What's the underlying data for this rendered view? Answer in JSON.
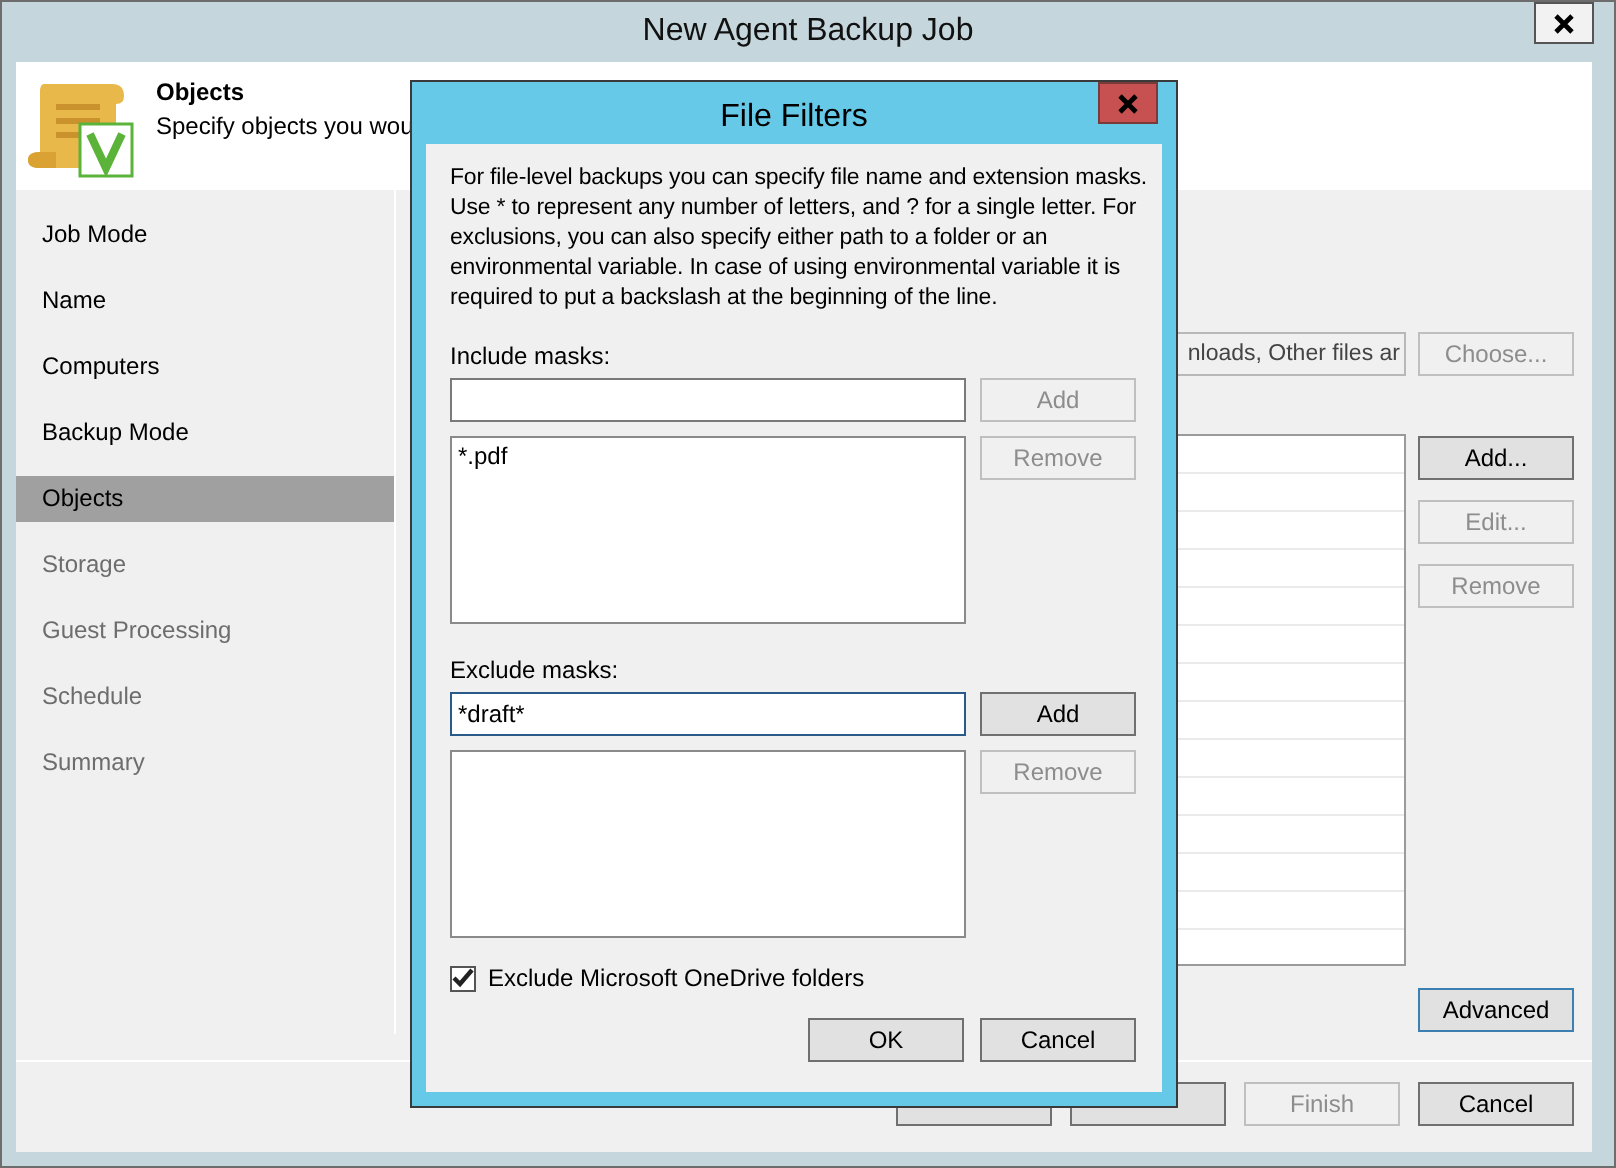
{
  "window": {
    "title": "New Agent Backup Job"
  },
  "header": {
    "title": "Objects",
    "subtitle": "Specify objects you wou"
  },
  "steps": [
    {
      "label": "Job Mode",
      "selected": false,
      "disabled": false
    },
    {
      "label": "Name",
      "selected": false,
      "disabled": false
    },
    {
      "label": "Computers",
      "selected": false,
      "disabled": false
    },
    {
      "label": "Backup Mode",
      "selected": false,
      "disabled": false
    },
    {
      "label": "Objects",
      "selected": true,
      "disabled": false
    },
    {
      "label": "Storage",
      "selected": false,
      "disabled": true
    },
    {
      "label": "Guest Processing",
      "selected": false,
      "disabled": true
    },
    {
      "label": "Schedule",
      "selected": false,
      "disabled": true
    },
    {
      "label": "Summary",
      "selected": false,
      "disabled": true
    }
  ],
  "objects": {
    "selection_field": "nloads, Other files ar",
    "choose_button": {
      "label": "Choose...",
      "disabled": true
    },
    "list_buttons": [
      {
        "label": "Add...",
        "disabled": false
      },
      {
        "label": "Edit...",
        "disabled": true
      },
      {
        "label": "Remove",
        "disabled": true
      }
    ],
    "advanced_button": {
      "label": "Advanced",
      "focused": true
    }
  },
  "footer_buttons": [
    {
      "disabled": false
    },
    {
      "disabled": false
    },
    {
      "label": "Finish",
      "disabled": true
    },
    {
      "label": "Cancel",
      "disabled": false
    }
  ],
  "dialog": {
    "title": "File Filters",
    "description": "For file-level backups you can specify file name and extension masks. Use * to represent any number of letters, and ? for a single letter. For exclusions, you can also specify either path to a folder or an environmental variable. In case of using environmental variable it is required to put a backslash at the beginning of the line.",
    "sections": [
      {
        "label": "Include masks:",
        "focused": false,
        "add_button": {
          "label": "Add",
          "disabled": true
        },
        "items": [
          "*.pdf"
        ],
        "remove_button": {
          "label": "Remove",
          "disabled": true
        }
      },
      {
        "label": "Exclude masks:",
        "value": "*draft*",
        "focused": true,
        "add_button": {
          "label": "Add",
          "disabled": false
        },
        "remove_button": {
          "label": "Remove",
          "disabled": true
        }
      }
    ],
    "onedrive_checkbox": {
      "label": "Exclude Microsoft OneDrive folders",
      "checked": true
    },
    "buttons": [
      {
        "label": "OK"
      },
      {
        "label": "Cancel"
      }
    ]
  }
}
